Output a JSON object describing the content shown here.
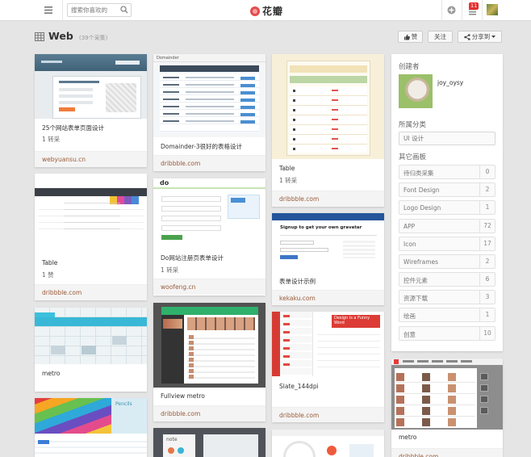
{
  "topbar": {
    "search_placeholder": "搜索你喜欢的",
    "logo_text": "花瓣",
    "notification_count": "11"
  },
  "header": {
    "title": "Web",
    "count": "(39个采集)",
    "like_label": "赞",
    "follow_label": "关注",
    "share_label": "分享到"
  },
  "pins": [
    {
      "title": "25个网站表单页面设计",
      "count": "1 转采",
      "source": "webyuansu.cn"
    },
    {
      "title": "Domainder-3很好的表格设计",
      "count": "",
      "source": "dribbble.com"
    },
    {
      "title": "Table",
      "count": "1 转采",
      "source": "dribbble.com"
    },
    {
      "title": "Table",
      "count": "1 赞",
      "source": "dribbble.com"
    },
    {
      "title": "Do网站注册页表单设计",
      "count": "1 转采",
      "source": "woofeng.cn"
    },
    {
      "title": "表单设计示例",
      "count": "",
      "source": "kekaku.com"
    },
    {
      "title": "metro",
      "count": "",
      "source": ""
    },
    {
      "title": "Fullview metro",
      "count": "",
      "source": "dribbble.com"
    },
    {
      "title": "Slate_144dpi",
      "count": "",
      "source": "dribbble.com"
    },
    {
      "title": "metro",
      "count": "",
      "source": "dribbble.com"
    }
  ],
  "pin_text": {
    "gravatar_heading": "Signup to get your own gravatar",
    "slate_promo": "Design is a Funny Word",
    "do_logo": "do",
    "note_label": "note",
    "domainder_label": "Domainder",
    "pencil_label": "Pencils"
  },
  "sidebar": {
    "creator_label": "创建者",
    "username": "joy_oysy",
    "category_label": "所属分类",
    "category": "UI 设计",
    "other_label": "其它画板",
    "boards": [
      {
        "name": "待归类采集",
        "count": "0"
      },
      {
        "name": "Font Design",
        "count": "2"
      },
      {
        "name": "Logo Design",
        "count": "1"
      },
      {
        "name": "APP",
        "count": "72"
      },
      {
        "name": "Icon",
        "count": "17"
      },
      {
        "name": "Wireframes",
        "count": "2"
      },
      {
        "name": "控件元素",
        "count": "6"
      },
      {
        "name": "资源下载",
        "count": "3"
      },
      {
        "name": "绘画",
        "count": "1"
      },
      {
        "name": "创意",
        "count": "10"
      }
    ]
  },
  "colors": {
    "brand": "#e54b4b",
    "source_link": "#9a5b3a",
    "page_bg": "#e5e5e5"
  },
  "icons": [
    "menu-icon",
    "search-icon",
    "add-icon",
    "bell-icon",
    "grid-icon",
    "thumb-up-icon",
    "share-icon",
    "chevron-down-icon"
  ]
}
